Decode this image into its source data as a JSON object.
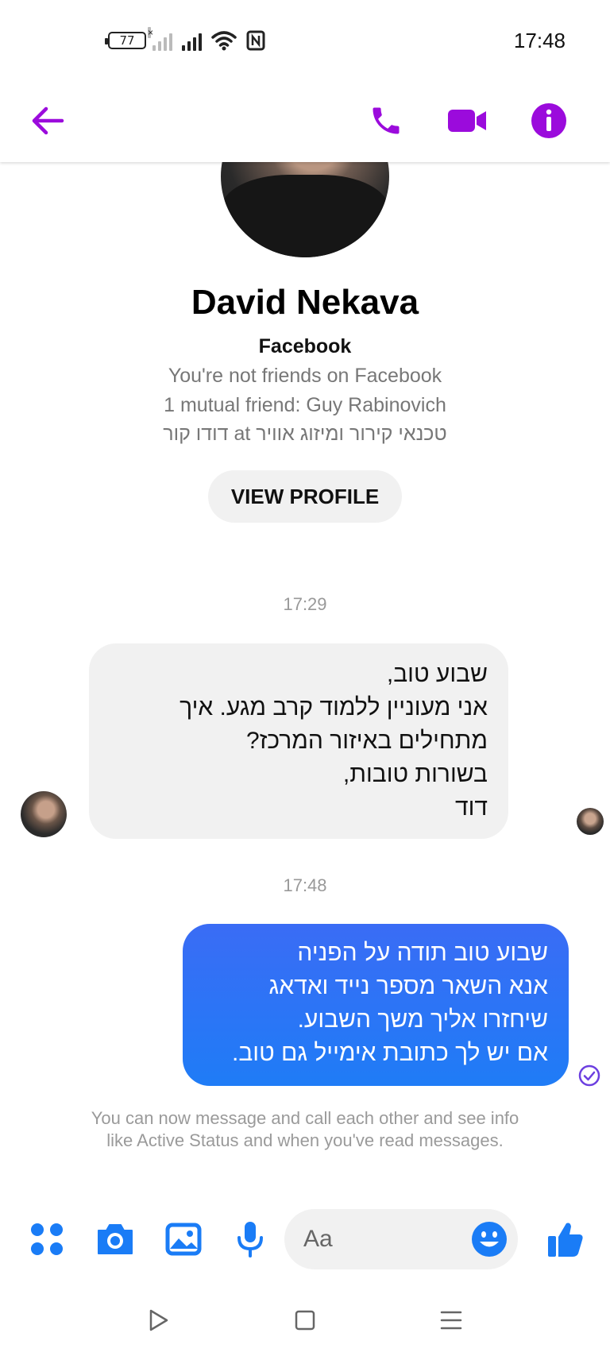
{
  "status_bar": {
    "battery": "77",
    "time": "17:48"
  },
  "colors": {
    "header_accent": "#9b0bdc",
    "messenger_blue": "#1a7cf6",
    "outgoing_bubble": "#2e74f6",
    "incoming_bubble": "#f1f1f1"
  },
  "header": {
    "icons": [
      "back-arrow-icon",
      "phone-icon",
      "video-camera-icon",
      "info-icon"
    ]
  },
  "profile": {
    "name": "David Nekava",
    "platform": "Facebook",
    "friendship": "You're not friends on Facebook",
    "mutual": "1 mutual friend: Guy Rabinovich",
    "work": "דודו קור at טכנאי קירור ומיזוג אוויר",
    "view_profile_label": "VIEW PROFILE"
  },
  "conversation": {
    "timestamp_1": "17:29",
    "incoming_message": "שבוע טוב,\nאני מעוניין ללמוד קרב מגע. איך\nמתחילים באיזור המרכז?\nבשורות טובות,\nדוד",
    "timestamp_2": "17:48",
    "outgoing_message": "שבוע טוב תודה על הפניה\nאנא השאר מספר נייד ואדאג\nשיחזרו אליך משך השבוע.\nאם יש לך כתובת אימייל גם טוב.",
    "notice": "You can now message and call each other and see info like Active Status and when you've read messages."
  },
  "composer": {
    "placeholder": "Aa",
    "icons": [
      "apps-grid-icon",
      "camera-icon",
      "gallery-icon",
      "microphone-icon",
      "emoji-icon",
      "thumbs-up-icon"
    ]
  },
  "navbar": {
    "icons": [
      "back-triangle-icon",
      "home-square-icon",
      "menu-lines-icon"
    ]
  }
}
